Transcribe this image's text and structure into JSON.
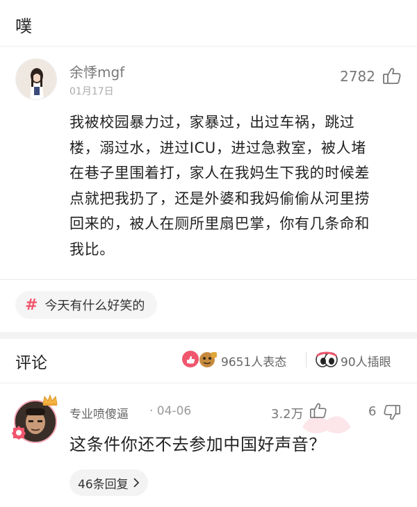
{
  "header": {
    "title": "噗"
  },
  "post": {
    "author": "余悸mgf",
    "date": "01月17日",
    "likes": "2782",
    "lines": [
      "我被校园暴力过，家暴过，出过车祸，跳过",
      "楼，溺过水，进过ICU，进过急救室，被人堵",
      "在巷子里围着打，家人在我妈生下我的时候差",
      "点就把我扔了，还是外婆和我妈偷偷从河里捞",
      "回来的，被人在厕所里扇巴掌，你有几条命和",
      "我比。"
    ],
    "topic": {
      "hash": "#",
      "label": "今天有什么好笑的"
    }
  },
  "comments_section": {
    "title": "评论",
    "reactions": "9651人表态",
    "watchers": "90人插眼"
  },
  "comment": {
    "user": "专业喷傻逼",
    "date": "· 04-06",
    "likes": "3.2万",
    "dislikes": "6",
    "text": "这条件你还不去参加中国好声音？",
    "replies": "46条回复"
  },
  "colors": {
    "accent": "#f0566d",
    "divider": "#ececec",
    "tag_bg": "#f5f5f5"
  }
}
